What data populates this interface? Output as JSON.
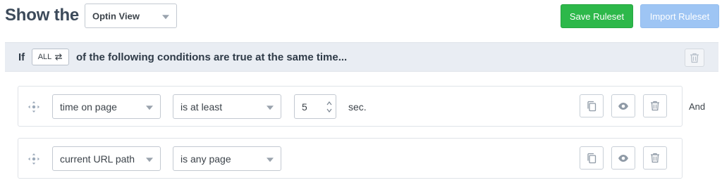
{
  "header": {
    "title": "Show the",
    "display_select": "Optin View",
    "save_label": "Save Ruleset",
    "import_label": "Import Ruleset"
  },
  "conditions": {
    "if_label": "If",
    "match_toggle": "ALL",
    "description": "of the following conditions are true at the same time..."
  },
  "rules": [
    {
      "field": "time on page",
      "operator": "is at least",
      "value": "5",
      "unit": "sec."
    },
    {
      "field": "current URL path",
      "operator": "is any page"
    }
  ],
  "joiner": "And",
  "colors": {
    "save_button": "#2db84a",
    "import_button": "#9ec5f4",
    "header_bg": "#e9edf3",
    "icon_color": "#8f9aa6"
  }
}
